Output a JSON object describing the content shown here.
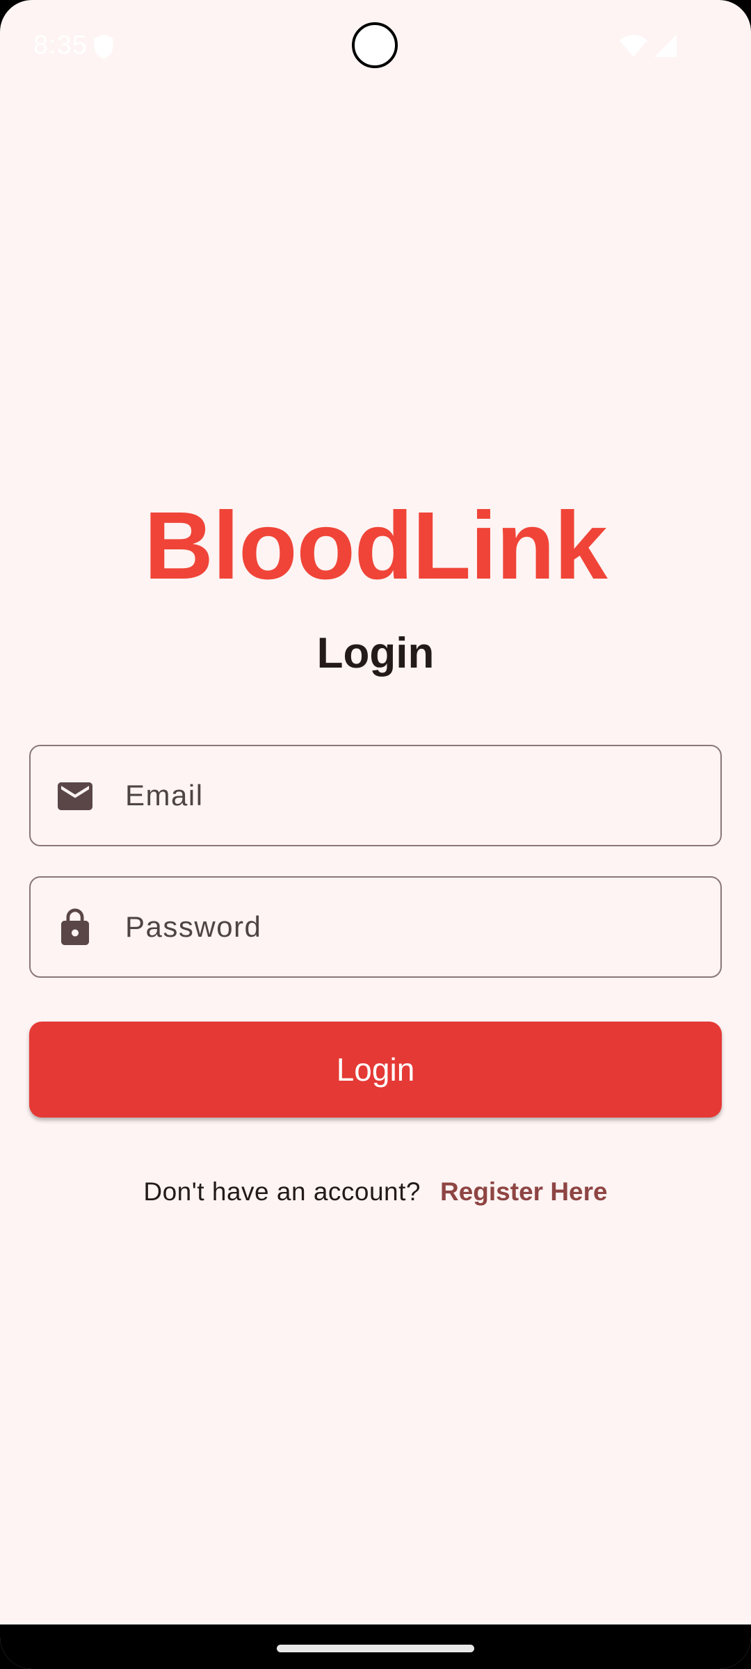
{
  "status_bar": {
    "time": "8:35",
    "icons": [
      "shield-icon",
      "wifi-icon",
      "signal-icon"
    ]
  },
  "app": {
    "title": "BloodLink",
    "heading": "Login"
  },
  "form": {
    "email": {
      "placeholder": "Email",
      "value": "",
      "icon": "mail-icon"
    },
    "password": {
      "placeholder": "Password",
      "value": "",
      "icon": "lock-icon"
    },
    "submit_label": "Login"
  },
  "register": {
    "prompt": "Don't have an account?",
    "link_label": "Register Here"
  },
  "colors": {
    "background": "#fdf4f3",
    "brand": "#f04438",
    "button": "#e53935",
    "link": "#8e4543",
    "icon": "#5a4646"
  }
}
